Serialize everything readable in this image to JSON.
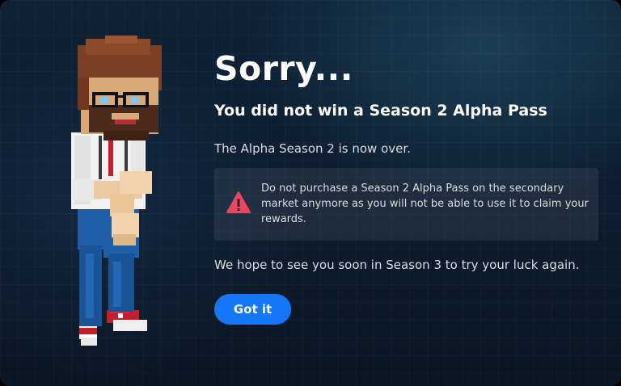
{
  "dialog": {
    "title": "Sorry...",
    "subtitle": "You did not win a Season 2 Alpha Pass",
    "status_text": "The Alpha Season 2 is now over.",
    "warning": {
      "icon": "warning-triangle-icon",
      "text": "Do not purchase a Season 2 Alpha Pass on the secondary market anymore as you will not be able to use it to claim your rewards."
    },
    "closing_text": "We hope to see you soon in Season 3 to try your luck again.",
    "button_label": "Got it"
  },
  "colors": {
    "background": "#0d1c2e",
    "accent": "#1477f8",
    "warning": "#f0445a",
    "text": "#ffffff",
    "muted_text": "#d8dde3"
  },
  "illustration": {
    "name": "voxel-character-avatar"
  }
}
